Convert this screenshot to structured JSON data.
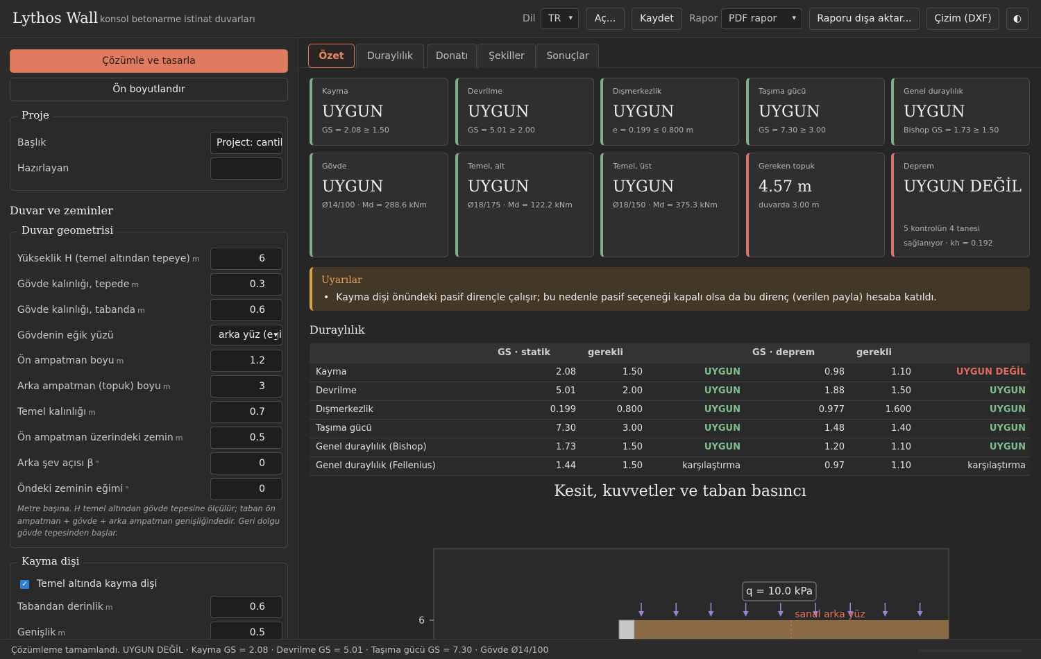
{
  "header": {
    "app_title": "Lythos Wall",
    "app_subtitle": "konsol betonarme istinat duvarları",
    "lang_label": "Dil",
    "lang_value": "TR",
    "open_label": "Aç...",
    "save_label": "Kaydet",
    "report_label": "Rapor",
    "report_format": "PDF rapor",
    "export_label": "Raporu dışa aktar...",
    "drawing_label": "Çizim (DXF)",
    "theme_icon": "◐"
  },
  "left": {
    "solve_label": "Çözümle ve tasarla",
    "predim_label": "Ön boyutlandır",
    "project": {
      "legend": "Proje",
      "title_label": "Başlık",
      "title_value": "Project: cantilever",
      "author_label": "Hazırlayan",
      "author_value": ""
    },
    "section_title": "Duvar ve zeminler",
    "geometry": {
      "legend": "Duvar geometrisi",
      "rows": [
        {
          "label": "Yükseklik H (temel altından tepeye)",
          "unit": "m",
          "value": "6"
        },
        {
          "label": "Gövde kalınlığı, tepede",
          "unit": "m",
          "value": "0.3"
        },
        {
          "label": "Gövde kalınlığı, tabanda",
          "unit": "m",
          "value": "0.6"
        },
        {
          "label": "Gövdenin eğik yüzü",
          "unit": "",
          "value": "arka yüz (eğik)"
        },
        {
          "label": "Ön ampatman boyu",
          "unit": "m",
          "value": "1.2"
        },
        {
          "label": "Arka ampatman (topuk) boyu",
          "unit": "m",
          "value": "3"
        },
        {
          "label": "Temel kalınlığı",
          "unit": "m",
          "value": "0.7"
        },
        {
          "label": "Ön ampatman üzerindeki zemin",
          "unit": "m",
          "value": "0.5"
        },
        {
          "label": "Arka şev açısı β",
          "unit": "°",
          "value": "0"
        },
        {
          "label": "Öndeki zeminin eğimi",
          "unit": "°",
          "value": "0"
        }
      ],
      "note": "Metre başına. H temel altından gövde tepesine ölçülür; taban ön ampatman + gövde + arka ampatman genişliğindedir. Geri dolgu gövde tepesinden başlar."
    },
    "key": {
      "legend": "Kayma dişi",
      "checkbox_label": "Temel altında kayma dişi",
      "checked": true,
      "rows": [
        {
          "label": "Tabandan derinlik",
          "unit": "m",
          "value": "0.6"
        },
        {
          "label": "Genişlik",
          "unit": "m",
          "value": "0.5"
        }
      ]
    }
  },
  "tabs": [
    {
      "label": "Özet",
      "active": true
    },
    {
      "label": "Duraylılık",
      "active": false
    },
    {
      "label": "Donatı",
      "active": false
    },
    {
      "label": "Şekiller",
      "active": false
    },
    {
      "label": "Sonuçlar",
      "active": false
    }
  ],
  "cards": [
    {
      "title": "Kayma",
      "value": "UYGUN",
      "sub": "GS = 2.08 ≥ 1.50",
      "status": "ok"
    },
    {
      "title": "Devrilme",
      "value": "UYGUN",
      "sub": "GS = 5.01 ≥ 2.00",
      "status": "ok"
    },
    {
      "title": "Dışmerkezlik",
      "value": "UYGUN",
      "sub": "e = 0.199 ≤ 0.800 m",
      "status": "ok"
    },
    {
      "title": "Taşıma gücü",
      "value": "UYGUN",
      "sub": "GS = 7.30 ≥ 3.00",
      "status": "ok"
    },
    {
      "title": "Genel duraylılık",
      "value": "UYGUN",
      "sub": "Bishop GS = 1.73 ≥ 1.50",
      "status": "ok"
    },
    {
      "title": "Gövde",
      "value": "UYGUN",
      "sub": "Ø14/100 · Md = 288.6 kNm",
      "status": "ok"
    },
    {
      "title": "Temel, alt",
      "value": "UYGUN",
      "sub": "Ø18/175 · Md = 122.2 kNm",
      "status": "ok"
    },
    {
      "title": "Temel, üst",
      "value": "UYGUN",
      "sub": "Ø18/150 · Md = 375.3 kNm",
      "status": "ok"
    },
    {
      "title": "Gereken topuk",
      "value": "4.57 m",
      "sub": "duvarda 3.00 m",
      "status": "bad"
    },
    {
      "title": "Deprem",
      "value": "UYGUN DEĞİL",
      "sub": "5 kontrolün 4 tanesi sağlanıyor · kh = 0.192",
      "status": "bad"
    }
  ],
  "warnings": {
    "title": "Uyarılar",
    "items": [
      "Kayma dişi önündeki pasif dirençle çalışır; bu nedenle pasif seçeneği kapalı olsa da bu direnç (verilen payla) hesaba katıldı."
    ]
  },
  "stability": {
    "title": "Duraylılık",
    "headers": [
      "",
      "GS · statik",
      "gerekli",
      "",
      "GS · deprem",
      "gerekli",
      ""
    ],
    "rows": [
      {
        "name": "Kayma",
        "gs_static": "2.08",
        "req_static": "1.50",
        "res_static": "UYGUN",
        "gs_eq": "0.98",
        "req_eq": "1.10",
        "res_eq": "UYGUN DEĞİL",
        "static_cls": "ok",
        "eq_cls": "nok"
      },
      {
        "name": "Devrilme",
        "gs_static": "5.01",
        "req_static": "2.00",
        "res_static": "UYGUN",
        "gs_eq": "1.88",
        "req_eq": "1.50",
        "res_eq": "UYGUN",
        "static_cls": "ok",
        "eq_cls": "ok"
      },
      {
        "name": "Dışmerkezlik",
        "gs_static": "0.199",
        "req_static": "0.800",
        "res_static": "UYGUN",
        "gs_eq": "0.977",
        "req_eq": "1.600",
        "res_eq": "UYGUN",
        "static_cls": "ok",
        "eq_cls": "ok"
      },
      {
        "name": "Taşıma gücü",
        "gs_static": "7.30",
        "req_static": "3.00",
        "res_static": "UYGUN",
        "gs_eq": "1.48",
        "req_eq": "1.40",
        "res_eq": "UYGUN",
        "static_cls": "ok",
        "eq_cls": "ok"
      },
      {
        "name": "Genel duraylılık (Bishop)",
        "gs_static": "1.73",
        "req_static": "1.50",
        "res_static": "UYGUN",
        "gs_eq": "1.20",
        "req_eq": "1.10",
        "res_eq": "UYGUN",
        "static_cls": "ok",
        "eq_cls": "ok"
      },
      {
        "name": "Genel duraylılık (Fellenius)",
        "gs_static": "1.44",
        "req_static": "1.50",
        "res_static": "karşılaştırma",
        "gs_eq": "0.97",
        "req_eq": "1.10",
        "res_eq": "karşılaştırma",
        "static_cls": "",
        "eq_cls": ""
      }
    ]
  },
  "figure": {
    "title": "Kesit, kuvvetler ve taban basıncı",
    "ytick": "6",
    "surcharge_label": "q = 10.0 kPa",
    "virtual_back_label": "sanal arka yüz",
    "colors": {
      "soil": "#8a6a45",
      "arrow": "#9b7fd0",
      "virtual": "#e0745f",
      "wall": "#c8c8c8"
    }
  },
  "status": {
    "text": "Çözümleme tamamlandı. UYGUN DEĞİL · Kayma GS = 2.08 · Devrilme GS = 5.01 · Taşıma gücü GS = 7.30 · Gövde Ø14/100"
  }
}
